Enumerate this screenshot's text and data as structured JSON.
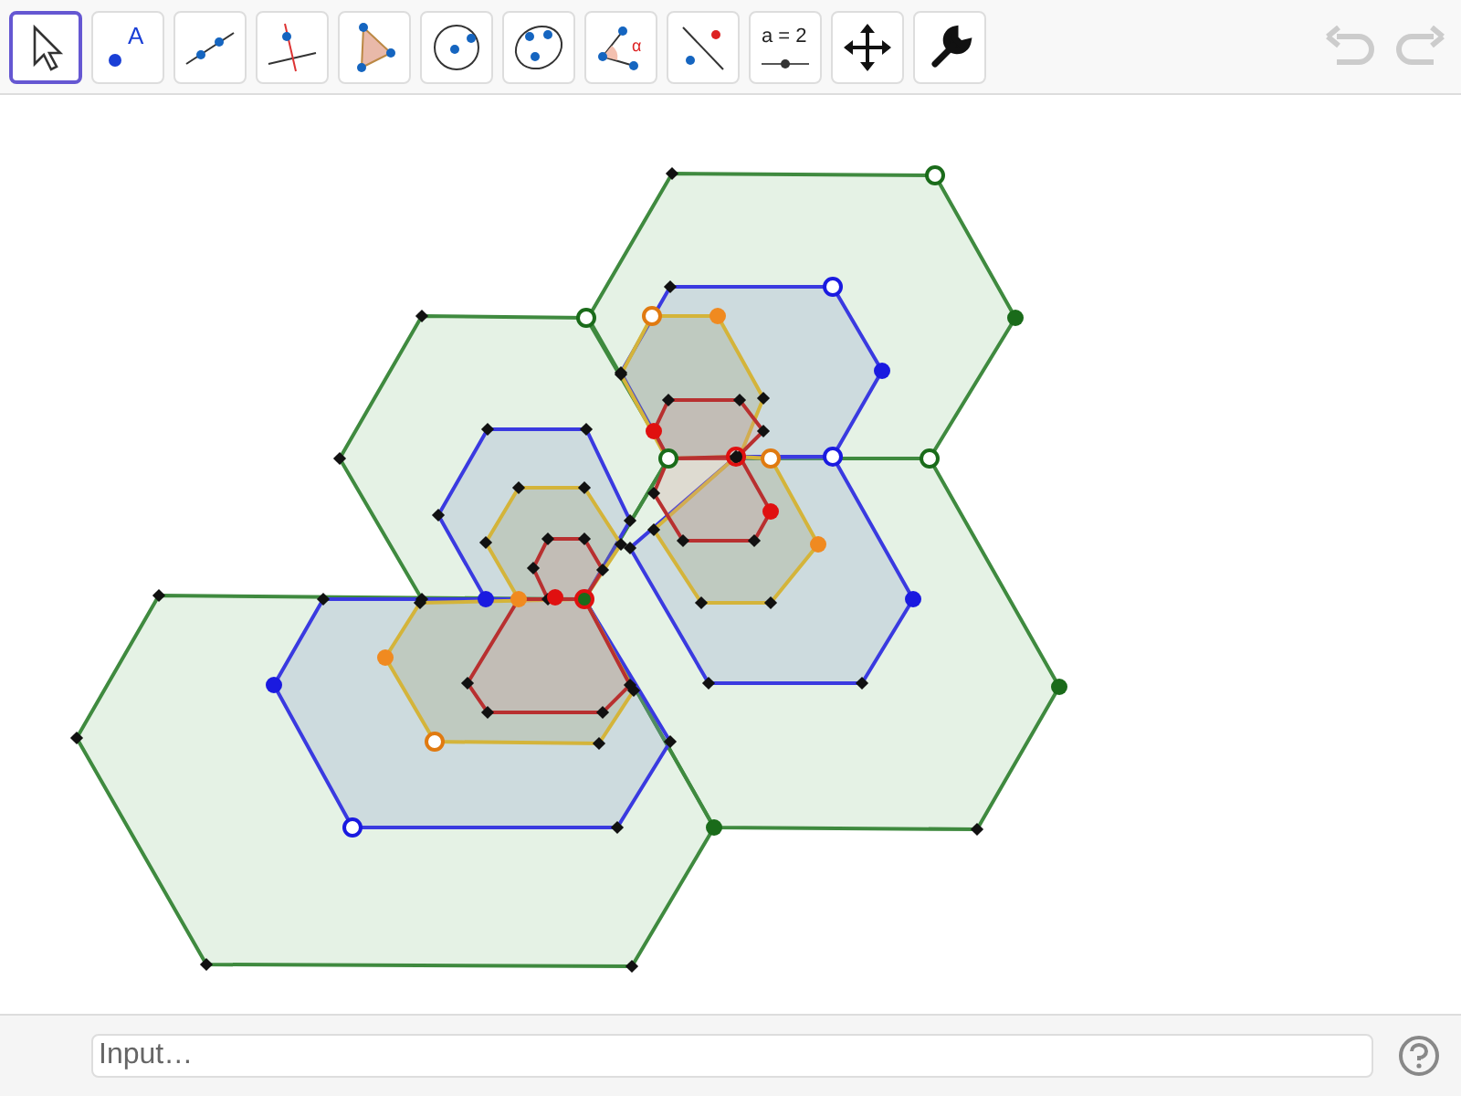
{
  "toolbar": {
    "tools": [
      {
        "kind": "move",
        "selected": true
      },
      {
        "kind": "point",
        "label": "A",
        "selected": false
      },
      {
        "kind": "line",
        "selected": false
      },
      {
        "kind": "perpendicular",
        "selected": false
      },
      {
        "kind": "polygon",
        "selected": false
      },
      {
        "kind": "circle",
        "selected": false
      },
      {
        "kind": "conic",
        "selected": false
      },
      {
        "kind": "angle",
        "label": "α",
        "selected": false
      },
      {
        "kind": "reflect",
        "selected": false
      },
      {
        "kind": "slider",
        "label": "a = 2",
        "selected": false
      },
      {
        "kind": "pan",
        "selected": false
      },
      {
        "kind": "tools",
        "selected": false
      }
    ],
    "undo": {
      "disabled": true
    },
    "redo": {
      "disabled": true
    }
  },
  "input_bar": {
    "placeholder": "Input…"
  }
}
